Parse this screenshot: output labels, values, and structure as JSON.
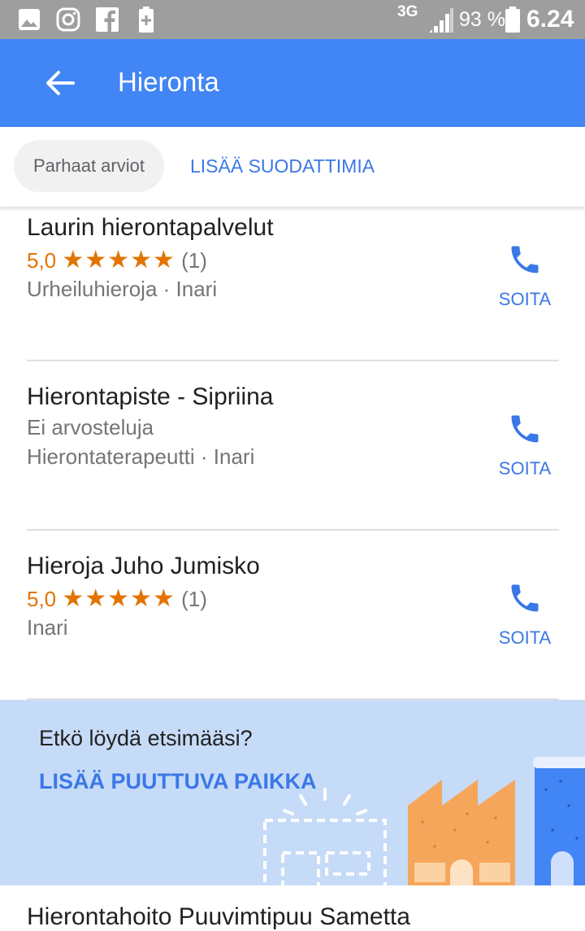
{
  "status_bar": {
    "network": "3G",
    "battery": "93 %",
    "time": "6.24",
    "icons": [
      "gallery-icon",
      "instagram-icon",
      "facebook-icon",
      "battery-saver-icon",
      "signal-icon",
      "battery-icon"
    ]
  },
  "app_bar": {
    "title": "Hieronta",
    "back_icon": "arrow-left-icon"
  },
  "filters": {
    "chip_label": "Parhaat arviot",
    "more_label": "LISÄÄ SUODATTIMIA"
  },
  "results": [
    {
      "name": "Laurin hierontapalvelut",
      "rating": "5,0",
      "stars": "★★★★★",
      "count": "(1)",
      "category": "Urheiluhieroja · Inari",
      "call": "SOITA"
    },
    {
      "name": "Hierontapiste - Sipriina",
      "reviews_text": "Ei arvosteluja",
      "category": "Hierontaterapeutti · Inari",
      "call": "SOITA"
    },
    {
      "name": "Hieroja Juho Jumisko",
      "rating": "5,0",
      "stars": "★★★★★",
      "count": "(1)",
      "category": "Inari",
      "call": "SOITA"
    }
  ],
  "banner": {
    "question": "Etkö löydä etsimääsi?",
    "link": "LISÄÄ PUUTTUVA PAIKKA"
  },
  "next_result": {
    "name": "Hierontahoito Puuvimtipuu Sametta"
  },
  "colors": {
    "app_bar": "#4285f4",
    "accent": "#3b78e7",
    "star": "#e37400",
    "banner": "#c6dbf7"
  }
}
